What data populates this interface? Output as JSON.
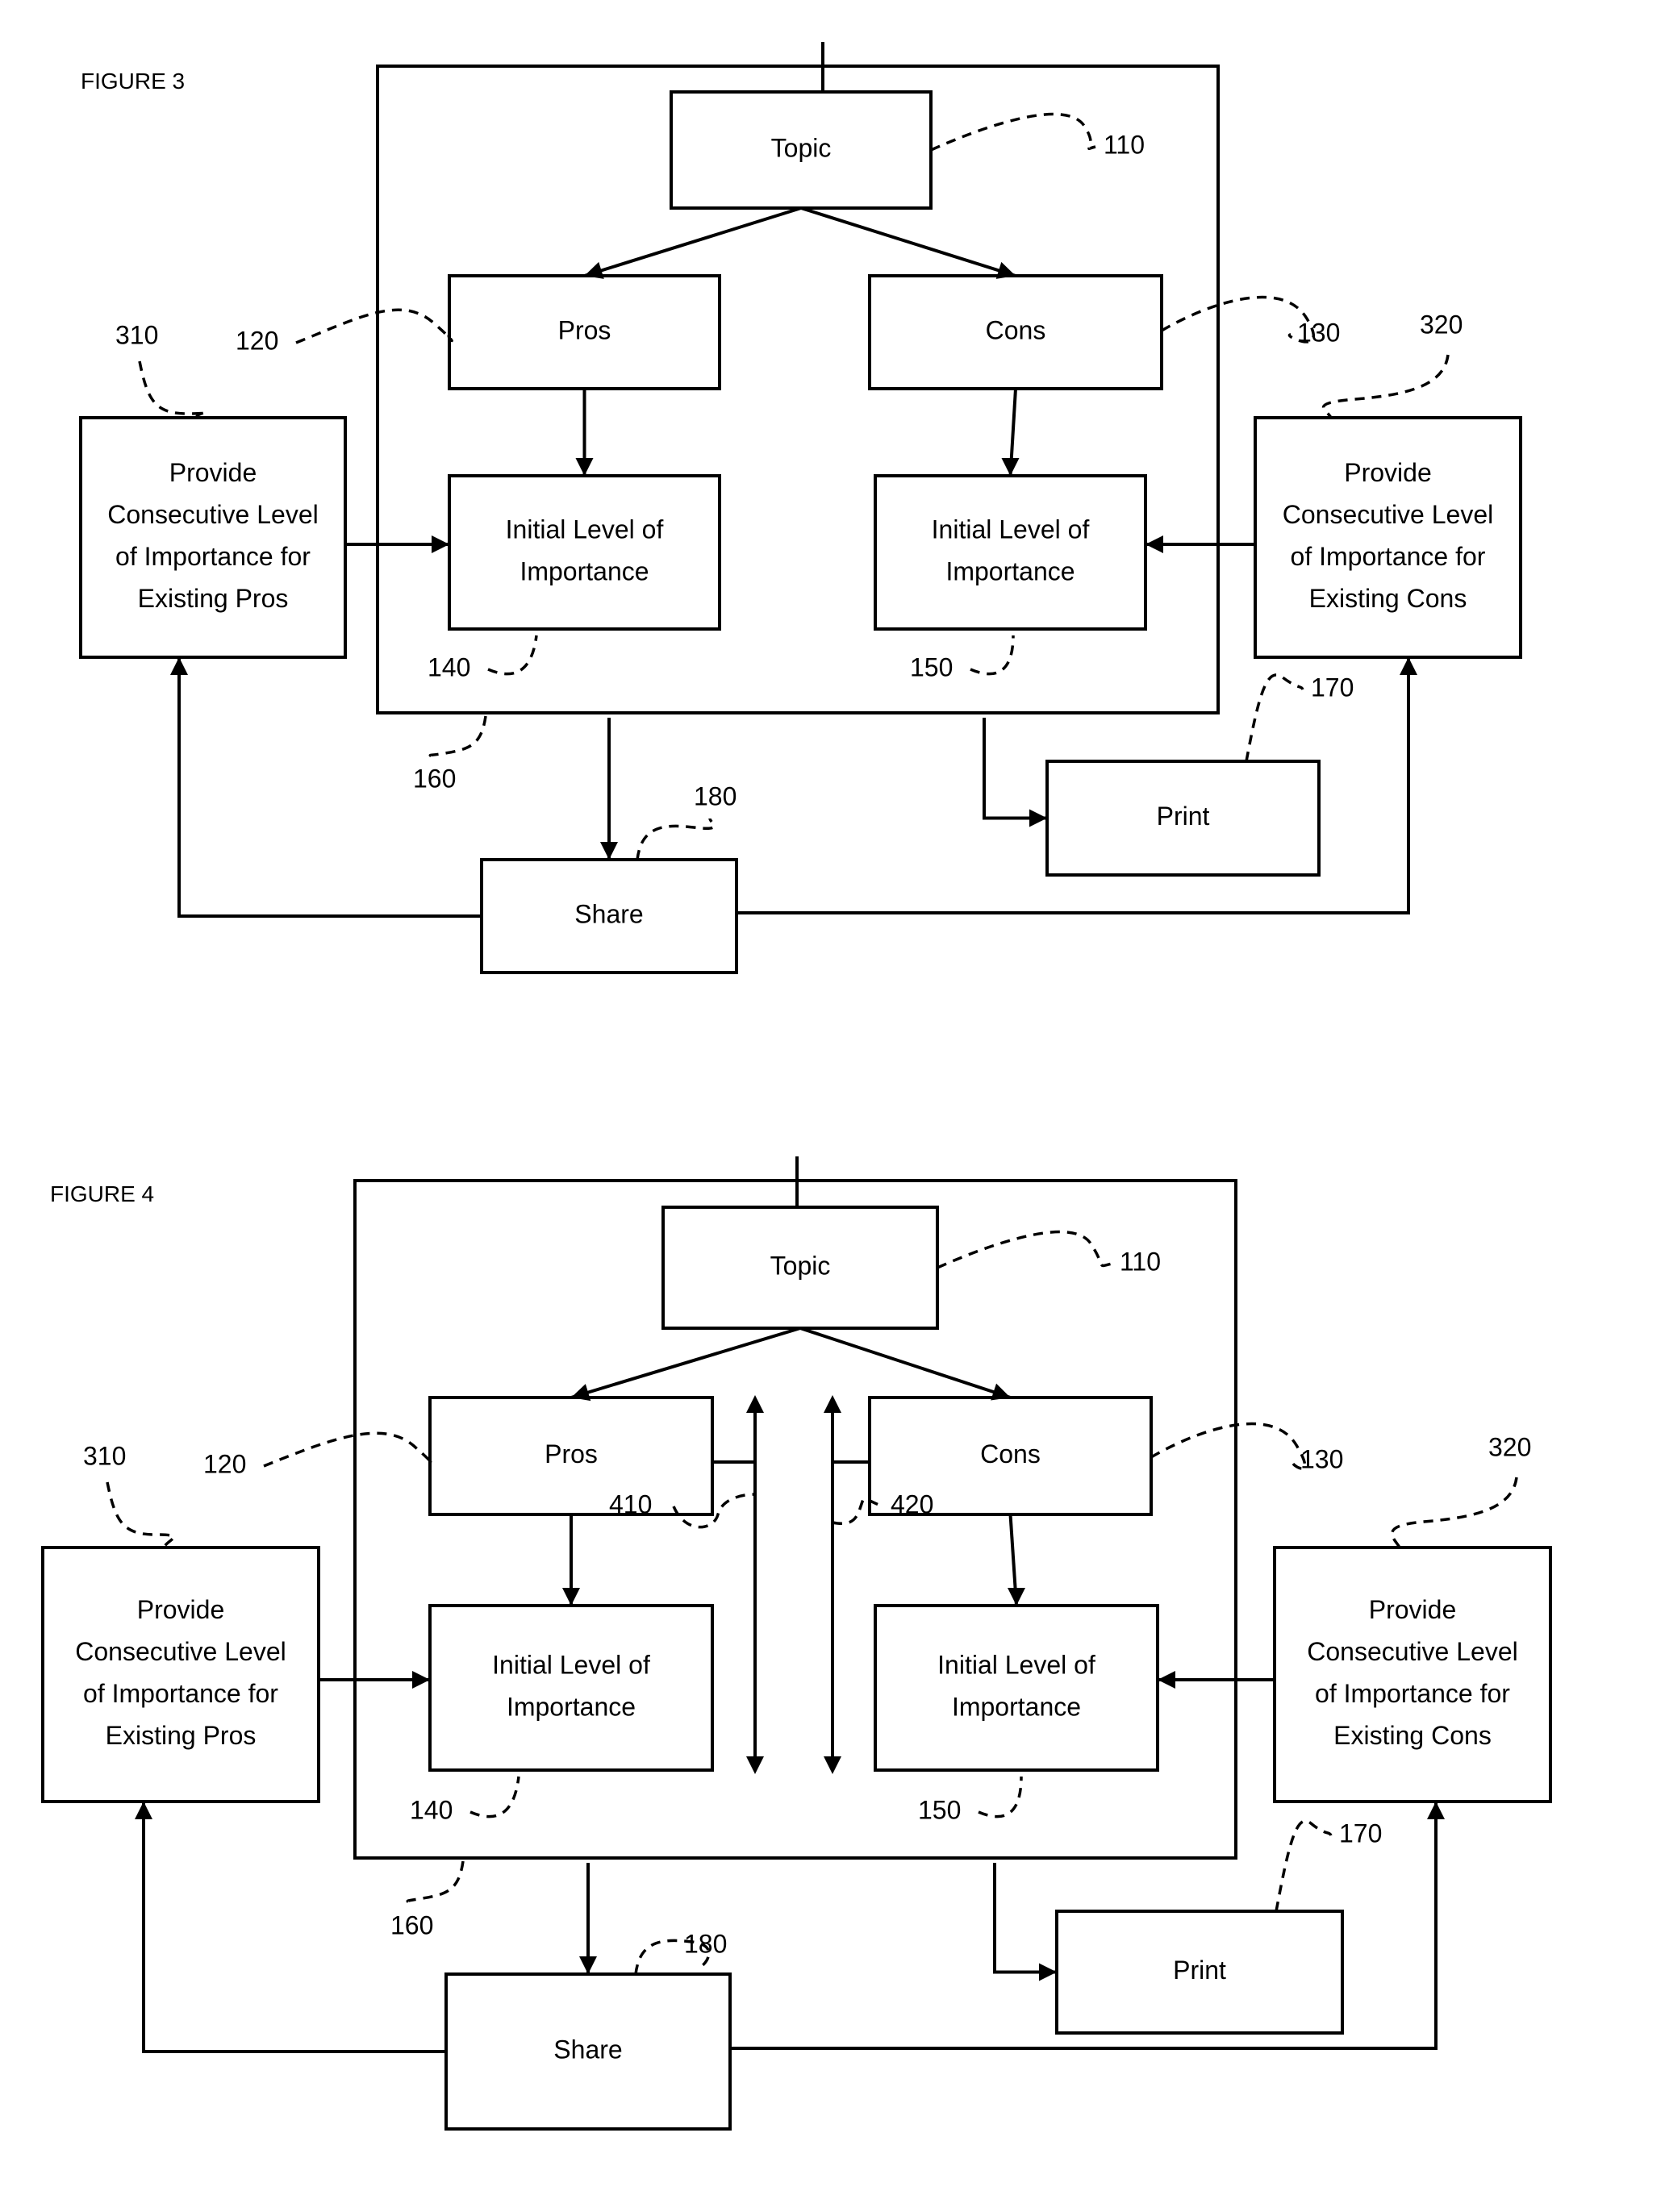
{
  "figures": [
    {
      "id": "fig3",
      "title": "FIGURE 3",
      "boxes": {
        "topic": {
          "label": [
            "Topic"
          ],
          "ref": "110"
        },
        "pros": {
          "label": [
            "Pros"
          ],
          "ref": "120"
        },
        "cons": {
          "label": [
            "Cons"
          ],
          "ref": "130"
        },
        "pros_initial": {
          "label": [
            "Initial Level of",
            "Importance"
          ],
          "ref": "140"
        },
        "cons_initial": {
          "label": [
            "Initial Level of",
            "Importance"
          ],
          "ref": "150"
        },
        "pros_consecutive": {
          "label": [
            "Provide",
            "Consecutive Level",
            "of Importance for",
            "Existing Pros"
          ],
          "ref": "310"
        },
        "cons_consecutive": {
          "label": [
            "Provide",
            "Consecutive Level",
            "of Importance for",
            "Existing Cons"
          ],
          "ref": "320"
        },
        "print": {
          "label": [
            "Print"
          ],
          "ref": "170"
        },
        "share": {
          "label": [
            "Share"
          ],
          "ref": "180"
        }
      },
      "container_ref": "160"
    },
    {
      "id": "fig4",
      "title": "FIGURE 4",
      "boxes": {
        "topic": {
          "label": [
            "Topic"
          ],
          "ref": "110"
        },
        "pros": {
          "label": [
            "Pros"
          ],
          "ref": "120"
        },
        "cons": {
          "label": [
            "Cons"
          ],
          "ref": "130"
        },
        "pros_initial": {
          "label": [
            "Initial Level of",
            "Importance"
          ],
          "ref": "140"
        },
        "cons_initial": {
          "label": [
            "Initial Level of",
            "Importance"
          ],
          "ref": "150"
        },
        "pros_consecutive": {
          "label": [
            "Provide",
            "Consecutive Level",
            "of Importance for",
            "Existing Pros"
          ],
          "ref": "310"
        },
        "cons_consecutive": {
          "label": [
            "Provide",
            "Consecutive Level",
            "of Importance for",
            "Existing Cons"
          ],
          "ref": "320"
        },
        "print": {
          "label": [
            "Print"
          ],
          "ref": "170"
        },
        "share": {
          "label": [
            "Share"
          ],
          "ref": "180"
        }
      },
      "container_ref": "160",
      "adjusters": {
        "pros_adjust_ref": "410",
        "cons_adjust_ref": "420"
      }
    }
  ]
}
